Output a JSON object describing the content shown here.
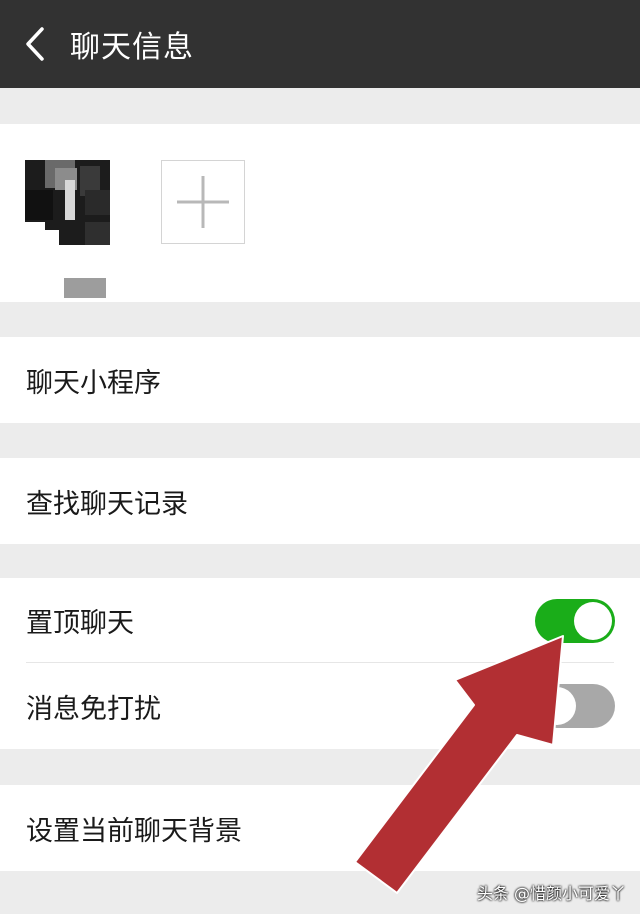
{
  "header": {
    "title": "聊天信息",
    "back_icon": "chevron-left-icon"
  },
  "members": {
    "add_icon": "plus-icon"
  },
  "cells": {
    "mini_programs": "聊天小程序",
    "search_history": "查找聊天记录",
    "pin_chat": "置顶聊天",
    "mute": "消息免打扰",
    "set_background": "设置当前聊天背景"
  },
  "toggles": {
    "pin_chat_on": true,
    "mute_on": false
  },
  "colors": {
    "header_bg": "#323232",
    "toggle_on": "#1aad19",
    "toggle_off": "#a8a8a8",
    "arrow": "#b22f33",
    "page_bg": "#ececec"
  },
  "watermark": "头条 @惜颜小可爱丫"
}
